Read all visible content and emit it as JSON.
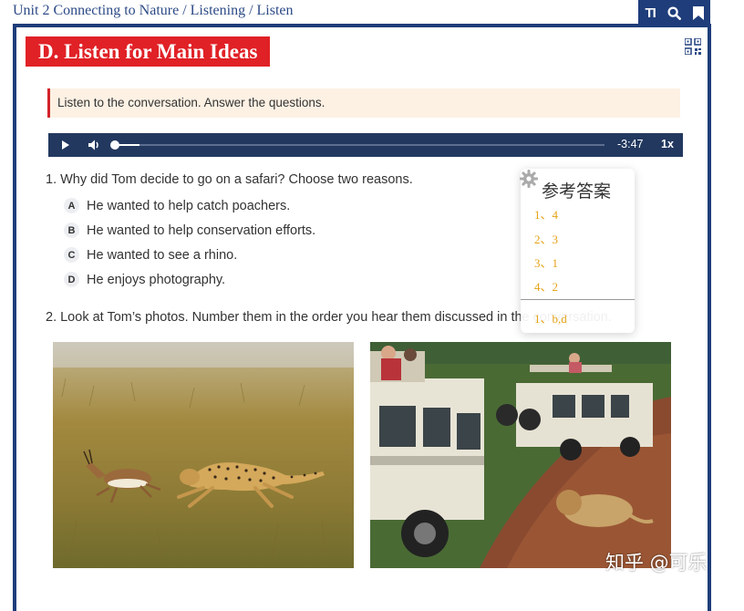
{
  "breadcrumb": "Unit 2 Connecting to Nature / Listening / Listen",
  "toolbar": {
    "text_size_label": "TI"
  },
  "section_title": "D. Listen for Main Ideas",
  "instruction": "Listen to the conversation. Answer the questions.",
  "player": {
    "time": "-3:47",
    "speed": "1x",
    "progress": 0.05
  },
  "question1": {
    "text": "1.  Why did Tom decide to go on a safari? Choose two reasons.",
    "options": [
      {
        "letter": "A",
        "text": "He wanted to help catch poachers."
      },
      {
        "letter": "B",
        "text": "He wanted to help conservation efforts."
      },
      {
        "letter": "C",
        "text": "He wanted to see a rhino."
      },
      {
        "letter": "D",
        "text": "He enjoys photography."
      }
    ]
  },
  "question2": {
    "text": "2. Look at Tom’s photos. Number them in the order you hear them discussed in the conversation."
  },
  "answer_popup": {
    "title": "参考答案",
    "answers": [
      "1、4",
      "2、3",
      "3、1",
      "4、2",
      "1、b,d"
    ]
  },
  "watermark": "知乎 @可乐",
  "colors": {
    "brand_blue": "#1e3d7a",
    "title_red": "#e02126",
    "answer_orange": "#e6a214",
    "player_bg": "#22385f"
  }
}
